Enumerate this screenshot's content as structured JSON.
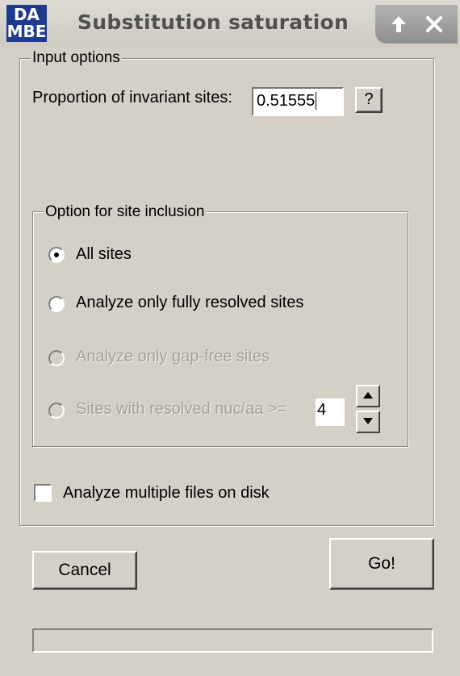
{
  "window": {
    "icon_line1": "DA",
    "icon_line2": "MBE",
    "title": "Substitution saturation",
    "up_glyph": "🡑",
    "close_glyph": "✕"
  },
  "input_options": {
    "legend": "Input options",
    "invariant_label": "Proportion of invariant sites:",
    "invariant_value": "0.51555",
    "help_label": "?"
  },
  "site_inclusion": {
    "legend": "Option for site inclusion",
    "options": [
      {
        "label": "All sites",
        "selected": true,
        "enabled": true
      },
      {
        "label": "Analyze only fully resolved sites",
        "selected": false,
        "enabled": true
      },
      {
        "label": "Analyze only gap-free sites",
        "selected": false,
        "enabled": false
      },
      {
        "label": "Sites with resolved nuc/aa >=",
        "selected": false,
        "enabled": false
      }
    ],
    "threshold_value": "4"
  },
  "multiple_files": {
    "label": "Analyze multiple files on disk",
    "checked": false
  },
  "buttons": {
    "cancel": "Cancel",
    "go": "Go!"
  },
  "progress": {
    "value": 0
  }
}
